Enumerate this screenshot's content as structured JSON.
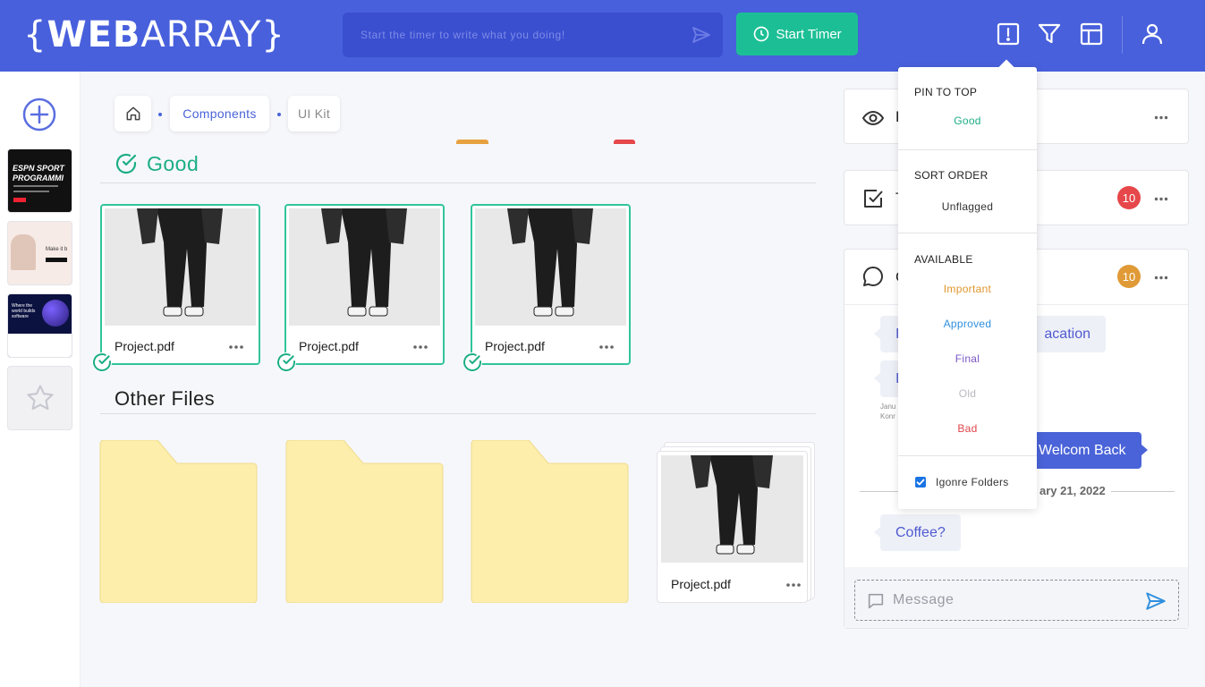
{
  "header": {
    "logo_left": "{",
    "logo_bold": "WEB",
    "logo_thin": "ARRAY",
    "logo_right": "}",
    "timer_placeholder": "Start the timer to write what you doing!",
    "start_timer_label": "Start Timer",
    "icons": [
      "alert-icon",
      "filter-icon",
      "layout-icon",
      "user-icon"
    ]
  },
  "sidebar": {
    "thumbs": [
      {
        "name": "espn-thumb",
        "text": "ESPN SPORT PROGRAMMI"
      },
      {
        "name": "makeit-thumb",
        "text": "Make it b"
      },
      {
        "name": "software-thumb",
        "text": "Where the world builds software"
      }
    ]
  },
  "breadcrumb": {
    "items": [
      "Components",
      "UI Kit"
    ]
  },
  "good_section": {
    "title": "Good",
    "files": [
      "Project.pdf",
      "Project.pdf",
      "Project.pdf"
    ]
  },
  "other_section": {
    "title": "Other Files",
    "stack_file": "Project.pdf"
  },
  "right_panel": {
    "cards": [
      {
        "title": "F",
        "icon": "eye-icon"
      },
      {
        "title": "T",
        "icon": "checkbox-icon",
        "badge": "10"
      },
      {
        "title": "C",
        "icon": "chat-icon",
        "badge": "10"
      }
    ],
    "chat": {
      "messages": [
        {
          "text_left": "I",
          "text_right": "acation",
          "from": "other"
        },
        {
          "text": "I",
          "from": "other"
        },
        {
          "text": "Welcom Back",
          "from": "me"
        },
        {
          "text": "Coffee?",
          "from": "other"
        }
      ],
      "meta_1": "Janu",
      "meta_2": "Konr",
      "date": "ary 21, 2022",
      "message_placeholder": "Message"
    }
  },
  "dropdown": {
    "pin_to_top": {
      "heading": "PIN TO TOP",
      "items": [
        {
          "label": "Good",
          "color": "#1cae86"
        }
      ]
    },
    "sort_order": {
      "heading": "SORT ORDER",
      "items": [
        {
          "label": "Unflagged",
          "color": "#333333"
        }
      ]
    },
    "available": {
      "heading": "AVAILABLE",
      "items": [
        {
          "label": "Important",
          "color": "#e0962c"
        },
        {
          "label": "Approved",
          "color": "#2f8fde"
        },
        {
          "label": "Final",
          "color": "#7a57c6"
        },
        {
          "label": "Old",
          "color": "#b9b9c0"
        },
        {
          "label": "Bad",
          "color": "#e0474c"
        }
      ]
    },
    "ignore_folders": {
      "label": "Igonre Folders",
      "checked": true
    }
  },
  "colors": {
    "primary": "#4860dc",
    "accent": "#1cbf95",
    "folder": "#fdeeab"
  }
}
